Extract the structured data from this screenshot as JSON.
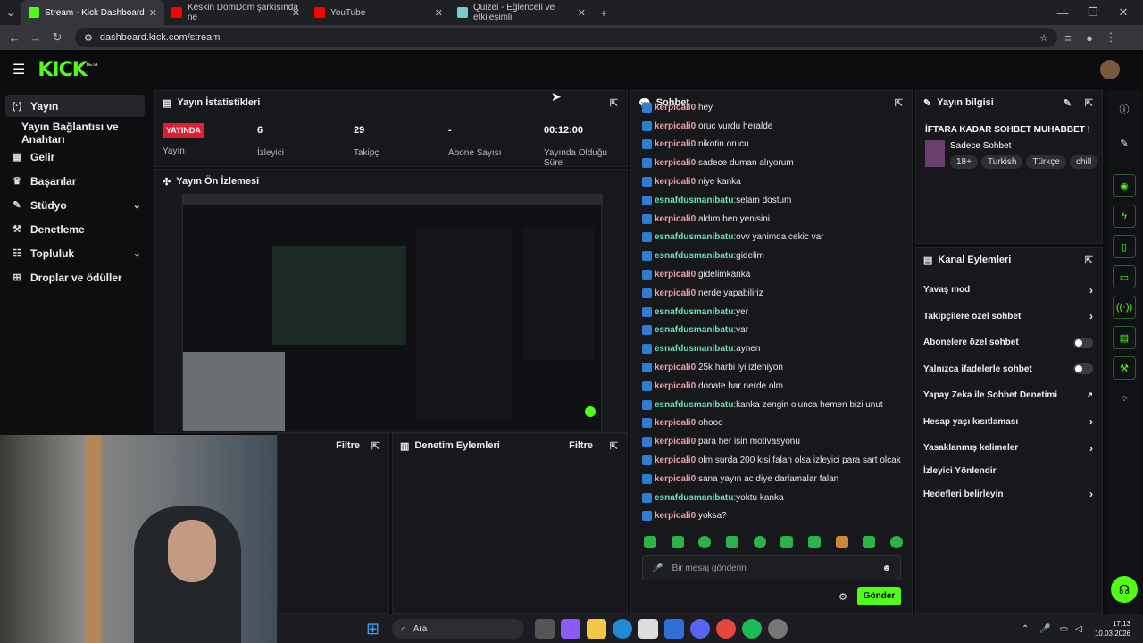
{
  "browser": {
    "tabs": [
      {
        "title": "Stream - Kick Dashboard",
        "color": "#53fc18"
      },
      {
        "title": "Keskin DomDom şarkısında ne",
        "color": "#ff0000"
      },
      {
        "title": "YouTube",
        "color": "#ff0000"
      },
      {
        "title": "Quizei - Eğlenceli ve etkileşimli",
        "color": "#7cc"
      }
    ],
    "url": "dashboard.kick.com/stream"
  },
  "app": {
    "logo": "KICK",
    "beta": "BETA"
  },
  "sidebar": {
    "items": [
      {
        "label": "Yayın",
        "icon": "broadcast-icon"
      },
      {
        "label": "Yayın Bağlantısı ve Anahtarı",
        "icon": ""
      },
      {
        "label": "Gelir",
        "icon": "revenue-icon"
      },
      {
        "label": "Başarılar",
        "icon": "trophy-icon"
      },
      {
        "label": "Stüdyo",
        "icon": "studio-icon"
      },
      {
        "label": "Denetleme",
        "icon": "wrench-icon"
      },
      {
        "label": "Topluluk",
        "icon": "community-icon"
      },
      {
        "label": "Droplar ve ödüller",
        "icon": "drops-icon"
      }
    ]
  },
  "stats": {
    "title": "Yayın İstatistikleri",
    "live_badge": "YAYINDA",
    "items": [
      {
        "value": "",
        "label": "Yayın"
      },
      {
        "value": "6",
        "label": "İzleyici"
      },
      {
        "value": "29",
        "label": "Takipçi"
      },
      {
        "value": "-",
        "label": "Abone Sayısı"
      },
      {
        "value": "00:12:00",
        "label": "Yayında Olduğu Süre"
      }
    ]
  },
  "preview": {
    "title": "Yayın Ön İzlemesi"
  },
  "filters": {
    "filter_label": "Filtre",
    "mod_title": "Denetim Eylemleri"
  },
  "chat": {
    "title": "Sohbet",
    "messages": [
      {
        "user": "kerpicali0",
        "text": "hey"
      },
      {
        "user": "kerpicali0",
        "text": "oruc vurdu heralde"
      },
      {
        "user": "kerpicali0",
        "text": "nikotin orucu"
      },
      {
        "user": "kerpicali0",
        "text": "sadece duman alıyorum"
      },
      {
        "user": "kerpicali0",
        "text": "niye kanka"
      },
      {
        "user": "esnafdusmanibatu",
        "text": "selam dostum"
      },
      {
        "user": "kerpicali0",
        "text": "aldım ben yenisini"
      },
      {
        "user": "esnafdusmanibatu",
        "text": "ovv yanimda cekic var"
      },
      {
        "user": "esnafdusmanibatu",
        "text": "gidelim"
      },
      {
        "user": "kerpicali0",
        "text": "gidelimkanka"
      },
      {
        "user": "kerpicali0",
        "text": "nerde yapabiliriz"
      },
      {
        "user": "esnafdusmanibatu",
        "text": "yer"
      },
      {
        "user": "esnafdusmanibatu",
        "text": "var"
      },
      {
        "user": "esnafdusmanibatu",
        "text": "aynen"
      },
      {
        "user": "kerpicali0",
        "text": "25k harbi iyi izleniyon"
      },
      {
        "user": "kerpicali0",
        "text": "donate bar nerde olm"
      },
      {
        "user": "esnafdusmanibatu",
        "text": "kanka zengin olunca hemen bizi unut"
      },
      {
        "user": "kerpicali0",
        "text": "ohooo"
      },
      {
        "user": "kerpicali0",
        "text": "para her isin motivasyonu"
      },
      {
        "user": "kerpicali0",
        "text": "olm surda 200 kisi falan olsa izleyici para sart olcak"
      },
      {
        "user": "kerpicali0",
        "text": "sana yayın ac diye darlamalar falan"
      },
      {
        "user": "esnafdusmanibatu",
        "text": "yoktu kanka"
      },
      {
        "user": "kerpicali0",
        "text": "yoksa?"
      }
    ],
    "placeholder": "Bir mesaj gönderin",
    "send": "Gönder"
  },
  "info": {
    "title": "Yayın bilgisi",
    "stream_title": "İFTARA KADAR SOHBET MUHABBET !",
    "category": "Sadece Sohbet",
    "tags": [
      "18+",
      "Turkish",
      "Türkçe",
      "chill"
    ]
  },
  "channel": {
    "title": "Kanal Eylemleri",
    "actions": [
      {
        "label": "Yavaş mod",
        "kind": "arrow"
      },
      {
        "label": "Takipçilere özel sohbet",
        "kind": "arrow"
      },
      {
        "label": "Abonelere özel sohbet",
        "kind": "toggle"
      },
      {
        "label": "Yalnızca ifadelerle sohbet",
        "kind": "toggle"
      },
      {
        "label": "Yapay Zeka ile Sohbet Denetimi",
        "kind": "external"
      },
      {
        "label": "Hesap yaşı kısıtlaması",
        "kind": "arrow"
      },
      {
        "label": "Yasaklanmış kelimeler",
        "kind": "arrow"
      },
      {
        "label": "İzleyici Yönlendir",
        "kind": "none"
      },
      {
        "label": "Hedefleri belirleyin",
        "kind": "arrow"
      }
    ]
  },
  "taskbar": {
    "search": "Ara",
    "time": "17:13",
    "date": "10.03.2026"
  },
  "colors": {
    "brand": "#53fc18",
    "live": "#e01e33"
  }
}
